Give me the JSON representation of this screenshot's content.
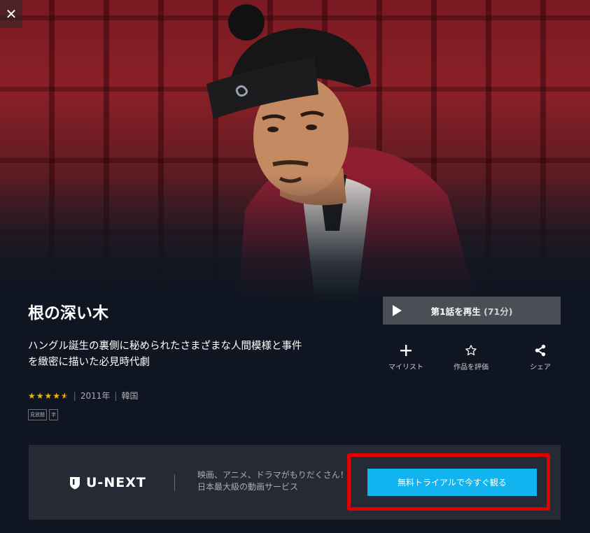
{
  "close_label": "✕",
  "title": "根の深い木",
  "description_lines": [
    "ハングル誕生の裏側に秘められたさまざまな人間模様と事件",
    "を緻密に描いた必見時代劇"
  ],
  "meta": {
    "stars": "★★★★",
    "half_star": "★",
    "rating": 4.5,
    "year": "2011年",
    "country": "韓国",
    "separator": "|"
  },
  "badges": [
    "見放題",
    "字"
  ],
  "play": {
    "label": "第1話を再生",
    "duration": "(71分)"
  },
  "actions": {
    "mylist": {
      "icon": "plus-icon",
      "label": "マイリスト"
    },
    "rate": {
      "icon": "star-outline-icon",
      "label": "作品を評価"
    },
    "share": {
      "icon": "share-icon",
      "label": "シェア"
    }
  },
  "promo": {
    "logo_text": "U-NEXT",
    "text_lines": [
      "映画、アニメ、ドラマがもりだくさん！",
      "日本最大級の動画サービス"
    ],
    "cta_label": "無料トライアルで今すぐ観る"
  },
  "colors": {
    "accent": "#11b4ee",
    "highlight_border": "#e00000",
    "star": "#f5b400",
    "background": "#0f1621",
    "promo_bg": "#252a35"
  }
}
